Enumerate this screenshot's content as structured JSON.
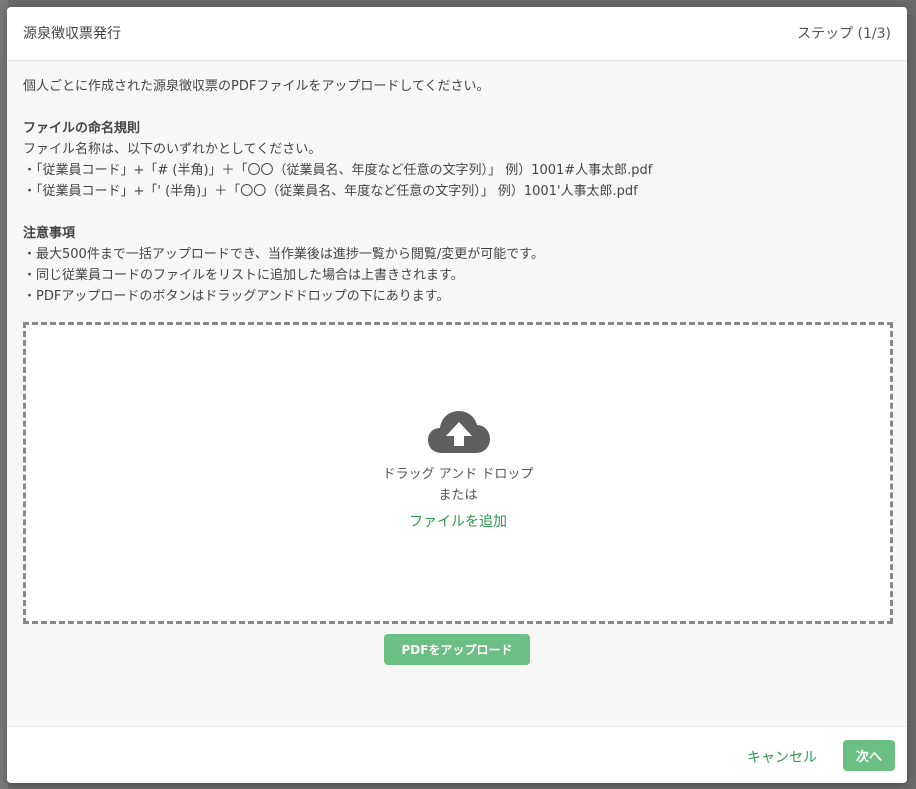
{
  "modal": {
    "title": "源泉徴収票発行",
    "step": "ステップ (1/3)",
    "intro": "個人ごとに作成された源泉徴収票のPDFファイルをアップロードしてください。",
    "naming_rules": {
      "title": "ファイルの命名規則",
      "description": "ファイル名称は、以下のいずれかとしてください。",
      "items": [
        "・「従業員コード」+「# (半角)」＋「〇〇（従業員名、年度など任意の文字列）」 例）1001#人事太郎.pdf",
        "・「従業員コード」+「' (半角)」＋「〇〇（従業員名、年度など任意の文字列）」 例）1001'人事太郎.pdf"
      ]
    },
    "notes": {
      "title": "注意事項",
      "items": [
        "・最大500件まで一括アップロードでき、当作業後は進捗一覧から閲覧/変更が可能です。",
        "・同じ従業員コードのファイルをリストに追加した場合は上書きされます。",
        "・PDFアップロードのボタンはドラッグアンドドロップの下にあります。"
      ]
    },
    "dropzone": {
      "icon": "cloud-upload-icon",
      "main_text": "ドラッグ アンド ドロップ",
      "or_text": "または",
      "add_file_link": "ファイルを追加"
    },
    "upload_button": "PDFをアップロード",
    "footer": {
      "cancel": "キャンセル",
      "next": "次へ"
    }
  },
  "colors": {
    "accent": "#2e9a4f",
    "button": "#6cbf83"
  }
}
